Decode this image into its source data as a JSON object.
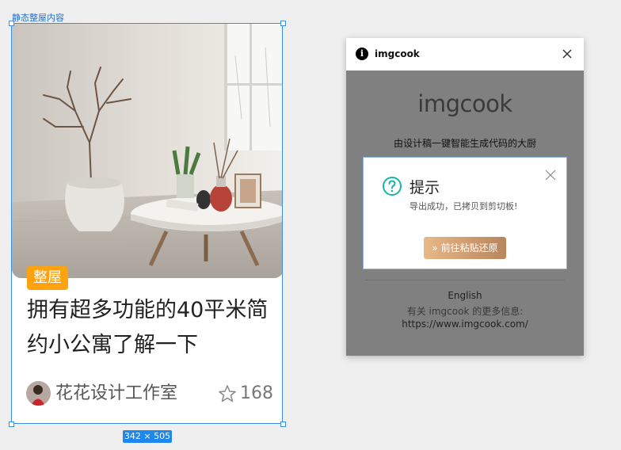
{
  "canvas": {
    "frame_label": "静态整屋内容",
    "size_badge": "342 × 505"
  },
  "card": {
    "tag": "整屋",
    "title": "拥有超多功能的40平米简约小公寓了解一下",
    "author": "花花设计工作室",
    "likes": "168",
    "icons": [
      "avatar",
      "star-icon"
    ]
  },
  "plugin_window": {
    "title": "imgcook",
    "logo_text": "imgcook",
    "tagline": "由设计稿一键智能生成代码的大厨",
    "language": "English",
    "more_info": "有关 imgcook 的更多信息:",
    "url": "https://www.imgcook.com/",
    "icons": [
      "info-icon",
      "close-icon"
    ]
  },
  "dialog": {
    "title": "提示",
    "message": "导出成功，已拷贝到剪切板!",
    "button_label": "» 前往粘贴还原",
    "icons": [
      "question-icon",
      "close-icon"
    ],
    "colors": {
      "accent": "#17b5a8",
      "button_start": "#e8b888",
      "button_end": "#b9855c"
    }
  },
  "colors": {
    "tag": "#ffa20f",
    "selection": "#3a8ee6",
    "window_overlay": "#808080"
  }
}
